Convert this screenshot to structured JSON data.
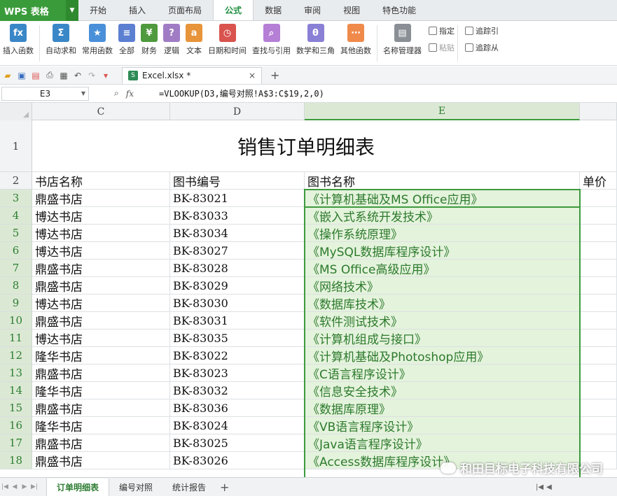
{
  "app": {
    "logo": "WPS 表格"
  },
  "tabs": [
    "开始",
    "插入",
    "页面布局",
    "公式",
    "数据",
    "审阅",
    "视图",
    "特色功能"
  ],
  "active_tab": "公式",
  "ribbon": {
    "buttons": [
      {
        "label": "插入函数",
        "icon": "fx-icon",
        "color": "#3a87c8",
        "glyph": "fx"
      },
      {
        "label": "自动求和",
        "icon": "sigma-icon",
        "color": "#3a87c8",
        "glyph": "Σ"
      },
      {
        "label": "常用函数",
        "icon": "star-book-icon",
        "color": "#4a90d9",
        "glyph": "★"
      },
      {
        "label": "全部",
        "icon": "book-icon",
        "color": "#5b7fd1",
        "glyph": "≡"
      },
      {
        "label": "财务",
        "icon": "finance-icon",
        "color": "#4f9a3e",
        "glyph": "¥"
      },
      {
        "label": "逻辑",
        "icon": "logic-icon",
        "color": "#a07cc5",
        "glyph": "?"
      },
      {
        "label": "文本",
        "icon": "text-icon",
        "color": "#e8943a",
        "glyph": "a"
      },
      {
        "label": "日期和时间",
        "icon": "clock-icon",
        "color": "#d9534f",
        "glyph": "◷"
      },
      {
        "label": "查找与引用",
        "icon": "lookup-icon",
        "color": "#b57fd6",
        "glyph": "⌕"
      },
      {
        "label": "数学和三角",
        "icon": "math-icon",
        "color": "#8a80d6",
        "glyph": "θ"
      },
      {
        "label": "其他函数",
        "icon": "more-icon",
        "color": "#f08a4b",
        "glyph": "⋯"
      },
      {
        "label": "名称管理器",
        "icon": "name-manager-icon",
        "color": "#8a8f96",
        "glyph": "▤"
      }
    ],
    "small_buttons": [
      {
        "label": "指定",
        "disabled": false
      },
      {
        "label": "粘贴",
        "disabled": true
      }
    ],
    "trace_buttons": [
      {
        "label": "追踪引"
      },
      {
        "label": "追踪从"
      }
    ]
  },
  "document_tab": {
    "filename": "Excel.xlsx *"
  },
  "formula_bar": {
    "name_box": "E3",
    "fx": "fx",
    "formula": "=VLOOKUP(D3,编号对照!A$3:C$19,2,0)"
  },
  "columns": [
    "C",
    "D",
    "E"
  ],
  "partial_column_header": "单价",
  "sheet_title": "销售订单明细表",
  "headers": {
    "c": "书店名称",
    "d": "图书编号",
    "e": "图书名称"
  },
  "rows": [
    {
      "n": "3",
      "store": "鼎盛书店",
      "code": "BK-83021",
      "book": "《计算机基础及MS Office应用》"
    },
    {
      "n": "4",
      "store": "博达书店",
      "code": "BK-83033",
      "book": "《嵌入式系统开发技术》"
    },
    {
      "n": "5",
      "store": "博达书店",
      "code": "BK-83034",
      "book": "《操作系统原理》"
    },
    {
      "n": "6",
      "store": "博达书店",
      "code": "BK-83027",
      "book": "《MySQL数据库程序设计》"
    },
    {
      "n": "7",
      "store": "鼎盛书店",
      "code": "BK-83028",
      "book": "《MS Office高级应用》"
    },
    {
      "n": "8",
      "store": "鼎盛书店",
      "code": "BK-83029",
      "book": "《网络技术》"
    },
    {
      "n": "9",
      "store": "博达书店",
      "code": "BK-83030",
      "book": "《数据库技术》"
    },
    {
      "n": "10",
      "store": "鼎盛书店",
      "code": "BK-83031",
      "book": "《软件测试技术》"
    },
    {
      "n": "11",
      "store": "博达书店",
      "code": "BK-83035",
      "book": "《计算机组成与接口》"
    },
    {
      "n": "12",
      "store": "隆华书店",
      "code": "BK-83022",
      "book": "《计算机基础及Photoshop应用》"
    },
    {
      "n": "13",
      "store": "鼎盛书店",
      "code": "BK-83023",
      "book": "《C语言程序设计》"
    },
    {
      "n": "14",
      "store": "隆华书店",
      "code": "BK-83032",
      "book": "《信息安全技术》"
    },
    {
      "n": "15",
      "store": "鼎盛书店",
      "code": "BK-83036",
      "book": "《数据库原理》"
    },
    {
      "n": "16",
      "store": "隆华书店",
      "code": "BK-83024",
      "book": "《VB语言程序设计》"
    },
    {
      "n": "17",
      "store": "鼎盛书店",
      "code": "BK-83025",
      "book": "《Java语言程序设计》"
    },
    {
      "n": "18",
      "store": "鼎盛书店",
      "code": "BK-83026",
      "book": "《Access数据库程序设计》"
    }
  ],
  "sheets": [
    "订单明细表",
    "编号对照",
    "统计报告"
  ],
  "active_sheet": "订单明细表",
  "watermark": "和田目标电子科技有限公司"
}
